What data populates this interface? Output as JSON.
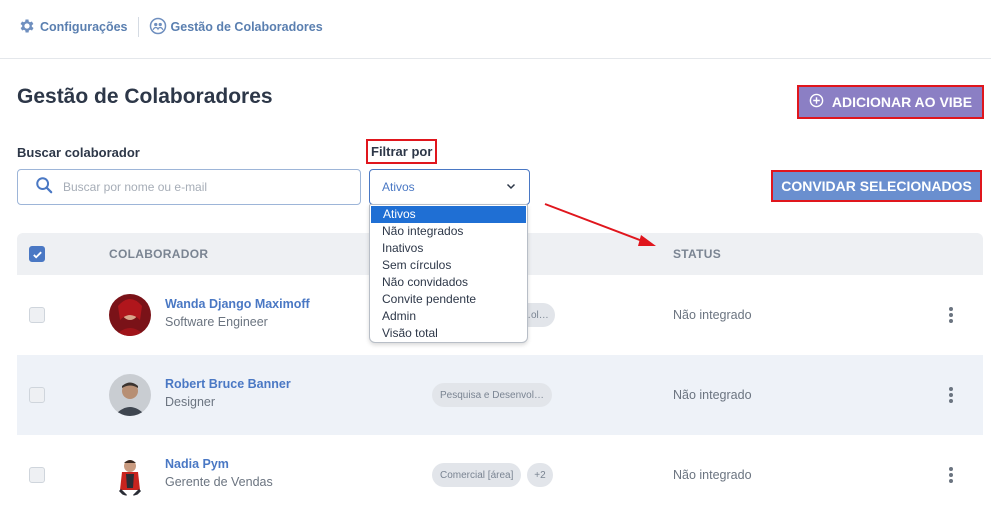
{
  "breadcrumb": {
    "items": [
      {
        "label": "Configurações",
        "icon": "gear-icon"
      },
      {
        "label": "Gestão de Colaboradores",
        "icon": "team-icon"
      }
    ]
  },
  "page": {
    "title": "Gestão de Colaboradores"
  },
  "actions": {
    "add_label": "ADICIONAR AO VIBE",
    "invite_label": "CONVIDAR SELECIONADOS"
  },
  "search": {
    "label": "Buscar colaborador",
    "placeholder": "Buscar por nome ou e-mail",
    "value": ""
  },
  "filter": {
    "label": "Filtrar por",
    "selected": "Ativos",
    "options": [
      "Ativos",
      "Não integrados",
      "Inativos",
      "Sem círculos",
      "Não convidados",
      "Convite pendente",
      "Admin",
      "Visão total"
    ]
  },
  "table": {
    "headers": {
      "collaborator": "COLABORADOR",
      "status": "STATUS"
    },
    "rows": [
      {
        "name": "Wanda Django Maximoff",
        "role": "Software Engineer",
        "tag": "…ol…",
        "extra": "",
        "status": "Não integrado"
      },
      {
        "name": "Robert Bruce Banner",
        "role": "Designer",
        "tag": "Pesquisa e Desenvol…",
        "extra": "",
        "status": "Não integrado"
      },
      {
        "name": "Nadia Pym",
        "role": "Gerente de Vendas",
        "tag": "Comercial [área]",
        "extra": "+2",
        "status": "Não integrado"
      }
    ]
  },
  "colors": {
    "accent": "#4a78c4",
    "add_button": "#8b7fc4",
    "invite_button": "#6a8fcf",
    "highlight": "#e0161d"
  }
}
